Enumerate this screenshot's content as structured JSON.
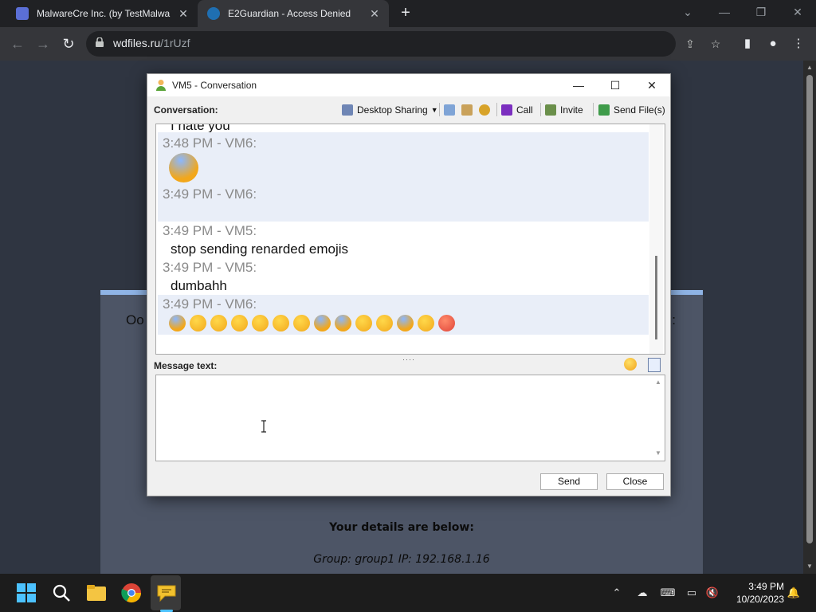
{
  "browser": {
    "tabs": [
      {
        "title": "MalwareCre Inc. (by TestMalwa",
        "active": false
      },
      {
        "title": "E2Guardian - Access Denied",
        "active": true
      }
    ],
    "new_tab": "+",
    "url_domain": "wdfiles.ru",
    "url_path": "/1rUzf"
  },
  "page": {
    "oops_text": "Oo",
    "colon_text": ":",
    "details_heading": "Your details are below:",
    "details_line": "Group: group1   IP: 192.168.1.16"
  },
  "conversation_window": {
    "title": "VM5 - Conversation",
    "conversation_label": "Conversation:",
    "toolbar": {
      "desktop_sharing": "Desktop Sharing",
      "call": "Call",
      "invite": "Invite",
      "send_files": "Send File(s)"
    },
    "messages": [
      {
        "header": "",
        "text": "I hate you",
        "sender": "VM5"
      },
      {
        "header": "3:48 PM - VM6:",
        "text": "",
        "sender": "VM6",
        "emojis": [
          "partying-face"
        ]
      },
      {
        "header": "3:49 PM - VM6:",
        "text": "",
        "sender": "VM6"
      },
      {
        "header": "3:49 PM - VM5:",
        "text": "stop sending renarded emojis",
        "sender": "VM5"
      },
      {
        "header": "3:49 PM - VM5:",
        "text": "dumbahh",
        "sender": "VM5"
      },
      {
        "header": "3:49 PM - VM6:",
        "text": "",
        "sender": "VM6",
        "emojis": [
          "partying-face",
          "kissing-face",
          "rolling-laughing-face",
          "crying-face",
          "crying-face",
          "disappointed-face",
          "expressionless-face",
          "fearful-face",
          "anxious-face",
          "confused-face",
          "kissing-face",
          "partying-face",
          "hushed-face",
          "angry-face"
        ]
      }
    ],
    "message_label": "Message text:",
    "message_value": "",
    "send_button": "Send",
    "close_button": "Close"
  },
  "taskbar": {
    "time": "3:49 PM",
    "date": "10/20/2023"
  },
  "colors": {
    "chrome_bg": "#202124",
    "toolbar_bg": "#35363a",
    "page_bg": "#2f3541",
    "card_bg": "#4d5566",
    "vm6_row": "#e9eef8"
  }
}
